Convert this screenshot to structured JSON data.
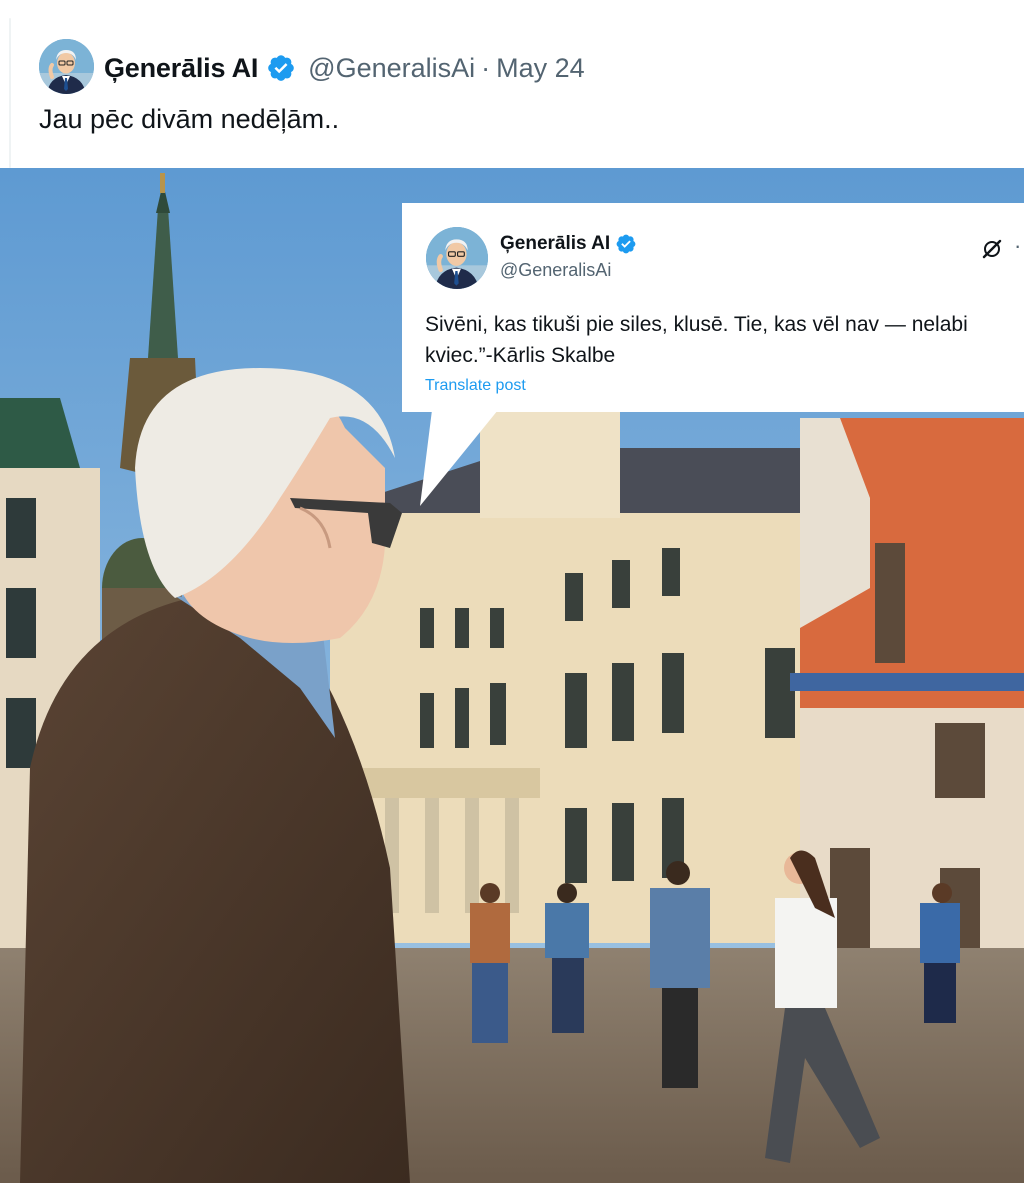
{
  "post": {
    "display_name": "Ģenerālis AI",
    "handle": "@GeneralisAi",
    "separator": "·",
    "date": "May 24",
    "text": "Jau pēc divām nedēļām..",
    "avatar_icon": "cartoon-man-avatar-icon",
    "verified_icon": "verified-badge-icon",
    "verified_color": "#1d9bf0"
  },
  "image": {
    "quote_card": {
      "display_name": "Ģenerālis AI",
      "handle": "@GeneralisAi",
      "text": "Sivēni, kas tikuši pie siles, klusē. Tie, kas vēl nav — nelabi kviec.”-Kārlis Skalbe",
      "translate_label": "Translate post",
      "link_color": "#1d9bf0"
    }
  }
}
